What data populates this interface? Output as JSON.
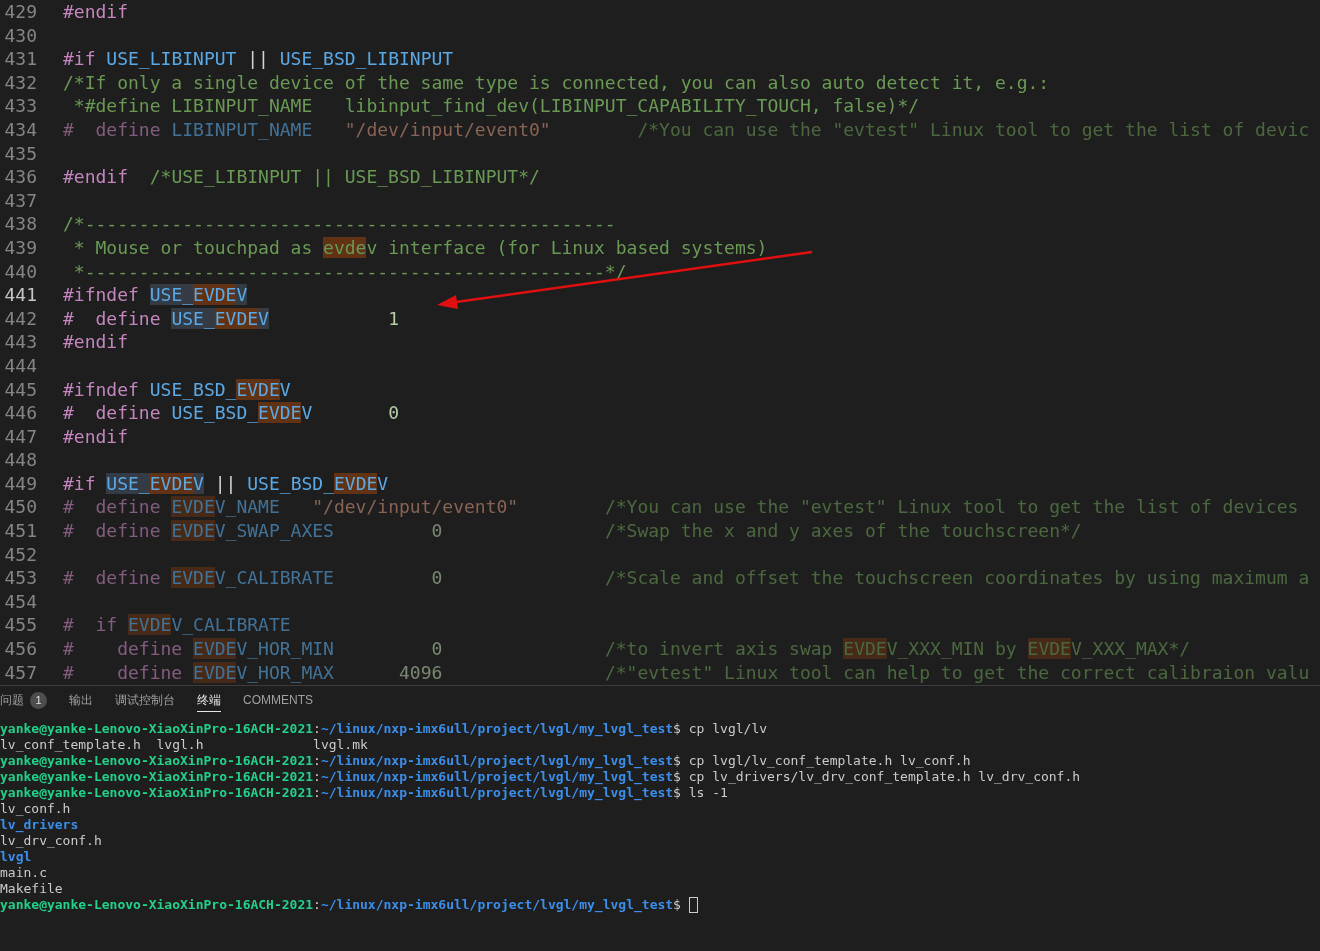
{
  "editor": {
    "lines": [
      {
        "number": "429",
        "tokens": [
          {
            "kind": "pre",
            "t": "#endif"
          }
        ]
      },
      {
        "number": "430"
      },
      {
        "number": "431",
        "tokens": [
          {
            "kind": "pre",
            "t": "#if "
          },
          {
            "kind": "macro",
            "t": "USE_LIBINPUT"
          },
          {
            "kind": "text",
            "t": " || "
          },
          {
            "kind": "macro",
            "t": "USE_BSD_LIBINPUT"
          }
        ]
      },
      {
        "number": "432",
        "tokens": [
          {
            "kind": "comment",
            "t": "/*If only a single device of the same type is connected, you can also auto detect it, e.g.:"
          }
        ]
      },
      {
        "number": "433",
        "tokens": [
          {
            "kind": "comment",
            "t": " *#define LIBINPUT_NAME   libinput_find_dev(LIBINPUT_CAPABILITY_TOUCH, false)*/"
          }
        ]
      },
      {
        "number": "434",
        "inactive": true,
        "tokens": [
          {
            "kind": "pre",
            "t": "#  define "
          },
          {
            "kind": "macro",
            "t": "LIBINPUT_NAME"
          },
          {
            "kind": "string",
            "t": "   \"/dev/input/event0\""
          },
          {
            "kind": "comment",
            "t": "        /*You can use the \"evtest\" Linux tool to get the list of devic"
          }
        ]
      },
      {
        "number": "435"
      },
      {
        "number": "436",
        "tokens": [
          {
            "kind": "pre",
            "t": "#endif"
          },
          {
            "kind": "comment",
            "t": "  /*USE_LIBINPUT || USE_BSD_LIBINPUT*/"
          }
        ]
      },
      {
        "number": "437"
      },
      {
        "number": "438",
        "tokens": [
          {
            "kind": "comment",
            "t": "/*-------------------------------------------------"
          }
        ]
      },
      {
        "number": "439",
        "tokens": [
          {
            "kind": "comment",
            "t": " * Mouse or touchpad as "
          },
          {
            "kind": "comment",
            "t": "evde",
            "find": true
          },
          {
            "kind": "comment",
            "t": "v interface (for Linux based systems)"
          }
        ]
      },
      {
        "number": "440",
        "tokens": [
          {
            "kind": "comment",
            "t": " *------------------------------------------------*/"
          }
        ]
      },
      {
        "number": "441",
        "current": true,
        "tokens": [
          {
            "kind": "pre",
            "t": "#ifndef "
          },
          {
            "kind": "macro",
            "t": "USE_",
            "word": true
          },
          {
            "kind": "macro",
            "t": "EVDE",
            "find": true
          },
          {
            "kind": "macro",
            "t": "V",
            "word": true
          }
        ]
      },
      {
        "number": "442",
        "tokens": [
          {
            "kind": "pre",
            "t": "#  define "
          },
          {
            "kind": "macro",
            "t": "USE_",
            "word": true
          },
          {
            "kind": "macro",
            "t": "EVDE",
            "find": true
          },
          {
            "kind": "macro",
            "t": "V",
            "word": true
          },
          {
            "kind": "number",
            "t": "           1"
          }
        ]
      },
      {
        "number": "443",
        "tokens": [
          {
            "kind": "pre",
            "t": "#endif"
          }
        ]
      },
      {
        "number": "444"
      },
      {
        "number": "445",
        "tokens": [
          {
            "kind": "pre",
            "t": "#ifndef "
          },
          {
            "kind": "macro",
            "t": "USE_BSD_"
          },
          {
            "kind": "macro",
            "t": "EVDE",
            "find": true
          },
          {
            "kind": "macro",
            "t": "V"
          }
        ]
      },
      {
        "number": "446",
        "tokens": [
          {
            "kind": "pre",
            "t": "#  define "
          },
          {
            "kind": "macro",
            "t": "USE_BSD_"
          },
          {
            "kind": "macro",
            "t": "EVDE",
            "find": true
          },
          {
            "kind": "macro",
            "t": "V"
          },
          {
            "kind": "number",
            "t": "       0"
          }
        ]
      },
      {
        "number": "447",
        "tokens": [
          {
            "kind": "pre",
            "t": "#endif"
          }
        ]
      },
      {
        "number": "448"
      },
      {
        "number": "449",
        "tokens": [
          {
            "kind": "pre",
            "t": "#if "
          },
          {
            "kind": "macro",
            "t": "USE_",
            "word": true
          },
          {
            "kind": "macro",
            "t": "EVDE",
            "find": true
          },
          {
            "kind": "macro",
            "t": "V",
            "word": true
          },
          {
            "kind": "text",
            "t": " || "
          },
          {
            "kind": "macro",
            "t": "USE_BSD_"
          },
          {
            "kind": "macro",
            "t": "EVDE",
            "find": true
          },
          {
            "kind": "macro",
            "t": "V"
          }
        ]
      },
      {
        "number": "450",
        "inactive": true,
        "tokens": [
          {
            "kind": "pre",
            "t": "#  define "
          },
          {
            "kind": "macro",
            "t": "EVDE",
            "find": true
          },
          {
            "kind": "macro",
            "t": "V_NAME"
          },
          {
            "kind": "string",
            "t": "   \"/dev/input/event0\""
          },
          {
            "kind": "comment",
            "t": "        /*You can use the \"evtest\" Linux tool to get the list of devices"
          }
        ]
      },
      {
        "number": "451",
        "inactive": true,
        "tokens": [
          {
            "kind": "pre",
            "t": "#  define "
          },
          {
            "kind": "macro",
            "t": "EVDE",
            "find": true
          },
          {
            "kind": "macro",
            "t": "V_SWAP_AXES"
          },
          {
            "kind": "number",
            "t": "         0"
          },
          {
            "kind": "comment",
            "t": "               /*Swap the x and y axes of the touchscreen*/"
          }
        ]
      },
      {
        "number": "452"
      },
      {
        "number": "453",
        "inactive": true,
        "tokens": [
          {
            "kind": "pre",
            "t": "#  define "
          },
          {
            "kind": "macro",
            "t": "EVDE",
            "find": true
          },
          {
            "kind": "macro",
            "t": "V_CALIBRATE"
          },
          {
            "kind": "number",
            "t": "         0"
          },
          {
            "kind": "comment",
            "t": "               /*Scale and offset the touchscreen coordinates by using maximum a"
          }
        ]
      },
      {
        "number": "454"
      },
      {
        "number": "455",
        "inactive": true,
        "tokens": [
          {
            "kind": "pre",
            "t": "#  if "
          },
          {
            "kind": "macro",
            "t": "EVDE",
            "find": true
          },
          {
            "kind": "macro",
            "t": "V_CALIBRATE"
          }
        ]
      },
      {
        "number": "456",
        "inactive": true,
        "tokens": [
          {
            "kind": "pre",
            "t": "#    define "
          },
          {
            "kind": "macro",
            "t": "EVDE",
            "find": true
          },
          {
            "kind": "macro",
            "t": "V_HOR_MIN"
          },
          {
            "kind": "number",
            "t": "         0"
          },
          {
            "kind": "comment",
            "t": "               /*to invert axis swap "
          },
          {
            "kind": "comment",
            "t": "EVDE",
            "find": true
          },
          {
            "kind": "comment",
            "t": "V_XXX_MIN by "
          },
          {
            "kind": "comment",
            "t": "EVDE",
            "find": true
          },
          {
            "kind": "comment",
            "t": "V_XXX_MAX*/"
          }
        ]
      },
      {
        "number": "457",
        "inactive": true,
        "tokens": [
          {
            "kind": "pre",
            "t": "#    define "
          },
          {
            "kind": "macro",
            "t": "EVDE",
            "find": true
          },
          {
            "kind": "macro",
            "t": "V_HOR_MAX"
          },
          {
            "kind": "number",
            "t": "      4096"
          },
          {
            "kind": "comment",
            "t": "               /*\"evtest\" Linux tool can help to get the correct calibraion valu"
          }
        ]
      }
    ]
  },
  "panel": {
    "tabs": [
      {
        "label": "问题",
        "badge": "1",
        "selected": false
      },
      {
        "label": "输出",
        "selected": false
      },
      {
        "label": "调试控制台",
        "selected": false
      },
      {
        "label": "终端",
        "selected": true
      },
      {
        "label": "COMMENTS",
        "selected": false
      }
    ],
    "terminal": [
      {
        "segments": [
          {
            "kind": "user",
            "t": "yanke@yanke-Lenovo-XiaoXinPro-16ACH-2021"
          },
          {
            "kind": "text",
            "t": ":"
          },
          {
            "kind": "path",
            "t": "~/linux/nxp-imx6ull/project/lvgl/my_lvgl_test"
          },
          {
            "kind": "text",
            "t": "$ cp lvgl/lv"
          }
        ]
      },
      {
        "segments": [
          {
            "kind": "text",
            "t": "lv_conf_template.h  lvgl.h              lvgl.mk"
          }
        ]
      },
      {
        "segments": [
          {
            "kind": "user",
            "t": "yanke@yanke-Lenovo-XiaoXinPro-16ACH-2021"
          },
          {
            "kind": "text",
            "t": ":"
          },
          {
            "kind": "path",
            "t": "~/linux/nxp-imx6ull/project/lvgl/my_lvgl_test"
          },
          {
            "kind": "text",
            "t": "$ cp lvgl/lv_conf_template.h lv_conf.h"
          }
        ]
      },
      {
        "segments": [
          {
            "kind": "user",
            "t": "yanke@yanke-Lenovo-XiaoXinPro-16ACH-2021"
          },
          {
            "kind": "text",
            "t": ":"
          },
          {
            "kind": "path",
            "t": "~/linux/nxp-imx6ull/project/lvgl/my_lvgl_test"
          },
          {
            "kind": "text",
            "t": "$ cp lv_drivers/lv_drv_conf_template.h lv_drv_conf.h"
          }
        ]
      },
      {
        "segments": [
          {
            "kind": "user",
            "t": "yanke@yanke-Lenovo-XiaoXinPro-16ACH-2021"
          },
          {
            "kind": "text",
            "t": ":"
          },
          {
            "kind": "path",
            "t": "~/linux/nxp-imx6ull/project/lvgl/my_lvgl_test"
          },
          {
            "kind": "text",
            "t": "$ ls -1"
          }
        ]
      },
      {
        "segments": [
          {
            "kind": "text",
            "t": "lv_conf.h"
          }
        ]
      },
      {
        "segments": [
          {
            "kind": "dir",
            "t": "lv_drivers"
          }
        ]
      },
      {
        "segments": [
          {
            "kind": "text",
            "t": "lv_drv_conf.h"
          }
        ]
      },
      {
        "segments": [
          {
            "kind": "dir",
            "t": "lvgl"
          }
        ]
      },
      {
        "segments": [
          {
            "kind": "text",
            "t": "main.c"
          }
        ]
      },
      {
        "segments": [
          {
            "kind": "text",
            "t": "Makefile"
          }
        ]
      },
      {
        "cursor": true,
        "segments": [
          {
            "kind": "user",
            "t": "yanke@yanke-Lenovo-XiaoXinPro-16ACH-2021"
          },
          {
            "kind": "text",
            "t": ":"
          },
          {
            "kind": "path",
            "t": "~/linux/nxp-imx6ull/project/lvgl/my_lvgl_test"
          },
          {
            "kind": "text",
            "t": "$"
          }
        ]
      }
    ]
  }
}
